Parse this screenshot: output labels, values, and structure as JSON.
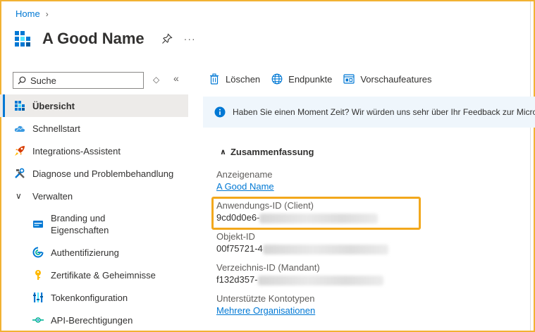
{
  "breadcrumb": {
    "home": "Home"
  },
  "header": {
    "title": "A Good Name",
    "more": "···"
  },
  "sidebar": {
    "search_placeholder": "Suche",
    "items": [
      {
        "label": "Übersicht",
        "icon": "grid-icon",
        "active": true
      },
      {
        "label": "Schnellstart",
        "icon": "cloud-icon"
      },
      {
        "label": "Integrations-Assistent",
        "icon": "rocket-icon"
      },
      {
        "label": "Diagnose und Problembehandlung",
        "icon": "tools-icon"
      },
      {
        "label": "Verwalten",
        "group": true
      },
      {
        "label": "Branding und\nEigenschaften",
        "icon": "branding-icon"
      },
      {
        "label": "Authentifizierung",
        "icon": "auth-icon"
      },
      {
        "label": "Zertifikate & Geheimnisse",
        "icon": "key-icon"
      },
      {
        "label": "Tokenkonfiguration",
        "icon": "token-icon"
      },
      {
        "label": "API-Berechtigungen",
        "icon": "api-icon"
      }
    ],
    "colors": {
      "accent": "#0078d4",
      "active_bg": "#edebe9"
    }
  },
  "toolbar": {
    "delete": "Löschen",
    "endpoints": "Endpunkte",
    "preview": "Vorschaufeatures"
  },
  "banner": {
    "text": "Haben Sie einen Moment Zeit? Wir würden uns sehr über Ihr Feedback zur Micros"
  },
  "essentials": {
    "title": "Zusammenfassung",
    "display_name_label": "Anzeigename",
    "display_name_value": "A Good Name",
    "app_id_label": "Anwendungs-ID (Client)",
    "app_id_value": "9cd0d0e6-",
    "object_id_label": "Objekt-ID",
    "object_id_value": "00f75721-4",
    "directory_id_label": "Verzeichnis-ID (Mandant)",
    "directory_id_value": "f132d357-",
    "account_types_label": "Unterstützte Kontotypen",
    "account_types_value": "Mehrere Organisationen"
  },
  "colors": {
    "highlight": "#f2a81d",
    "link": "#0078d4",
    "banner_bg": "#eff6fc"
  }
}
